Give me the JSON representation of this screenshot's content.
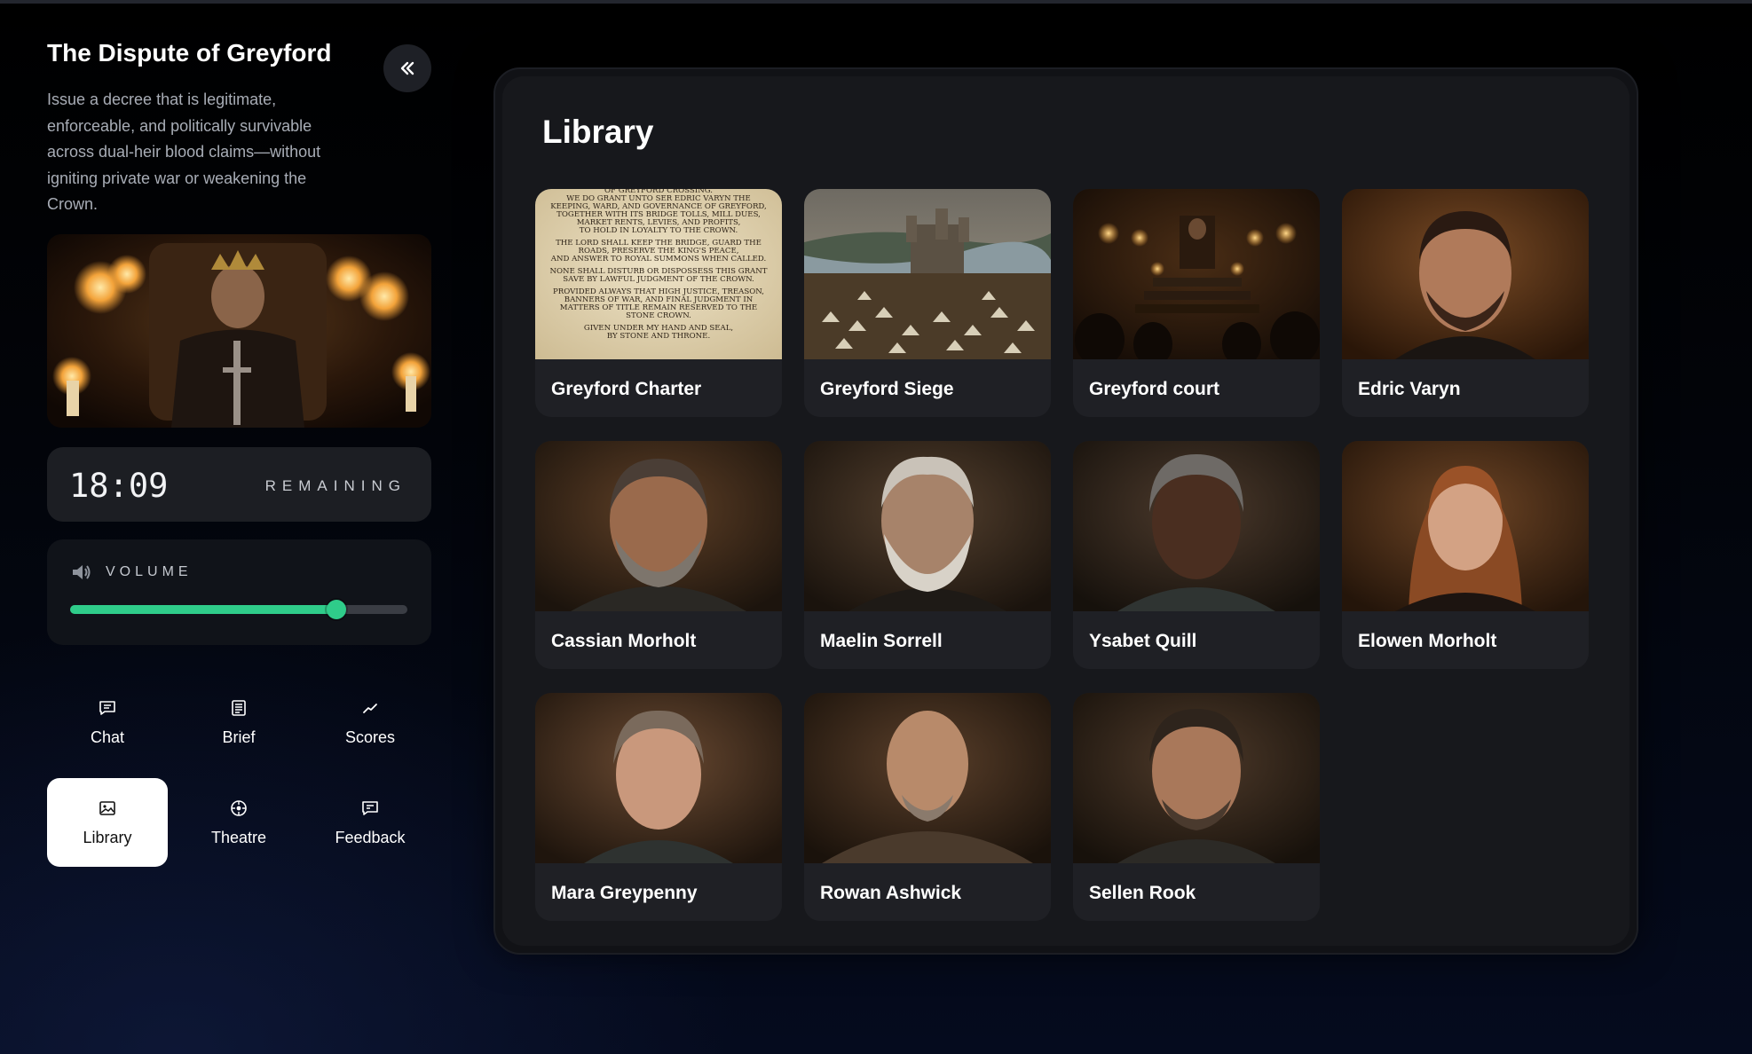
{
  "sidebar": {
    "title": "The Dispute of Greyford",
    "description": "Issue a decree that is legitimate, enforceable, and politically survivable across dual-heir blood claims—without igniting private war or weakening the Crown.",
    "timer": {
      "time": "18:09",
      "label": "REMAINING"
    },
    "volume": {
      "label": "VOLUME",
      "level_percent": 79
    },
    "nav": [
      {
        "label": "Chat",
        "icon": "chat-icon",
        "active": false
      },
      {
        "label": "Brief",
        "icon": "document-icon",
        "active": false
      },
      {
        "label": "Scores",
        "icon": "chart-icon",
        "active": false
      },
      {
        "label": "Library",
        "icon": "image-icon",
        "active": true
      },
      {
        "label": "Theatre",
        "icon": "target-icon",
        "active": false
      },
      {
        "label": "Feedback",
        "icon": "feedback-icon",
        "active": false
      }
    ]
  },
  "library": {
    "title": "Library",
    "items": [
      {
        "name": "Greyford Charter",
        "kind": "charter"
      },
      {
        "name": "Greyford Siege",
        "kind": "siege"
      },
      {
        "name": "Greyford court",
        "kind": "court"
      },
      {
        "name": "Edric Varyn",
        "kind": "portrait"
      },
      {
        "name": "Cassian Morholt",
        "kind": "portrait"
      },
      {
        "name": "Maelin Sorrell",
        "kind": "portrait"
      },
      {
        "name": "Ysabet Quill",
        "kind": "portrait"
      },
      {
        "name": "Elowen Morholt",
        "kind": "portrait"
      },
      {
        "name": "Mara Greypenny",
        "kind": "portrait"
      },
      {
        "name": "Rowan Ashwick",
        "kind": "portrait"
      },
      {
        "name": "Sellen Rook",
        "kind": "portrait"
      }
    ]
  },
  "charter_text": [
    "OF GREYFORD CROSSING.",
    "WE DO GRANT UNTO SER EDRIC VARYN THE",
    "KEEPING, WARD, AND GOVERNANCE OF GREYFORD,",
    "TOGETHER WITH ITS BRIDGE TOLLS, MILL DUES,",
    "MARKET RENTS, LEVIES, AND PROFITS,",
    "TO HOLD IN LOYALTY TO THE CROWN.",
    "THE LORD SHALL KEEP THE BRIDGE, GUARD THE",
    "ROADS, PRESERVE THE KING'S PEACE,",
    "AND ANSWER TO ROYAL SUMMONS WHEN CALLED.",
    "NONE SHALL DISTURB OR DISPOSSESS THIS GRANT",
    "SAVE BY LAWFUL JUDGMENT OF THE CROWN.",
    "PROVIDED ALWAYS THAT HIGH JUSTICE, TREASON,",
    "BANNERS OF WAR, AND FINAL JUDGMENT IN",
    "MATTERS OF TITLE REMAIN RESERVED TO THE",
    "STONE CROWN.",
    "GIVEN UNDER MY HAND AND SEAL,",
    "BY STONE AND THRONE."
  ]
}
